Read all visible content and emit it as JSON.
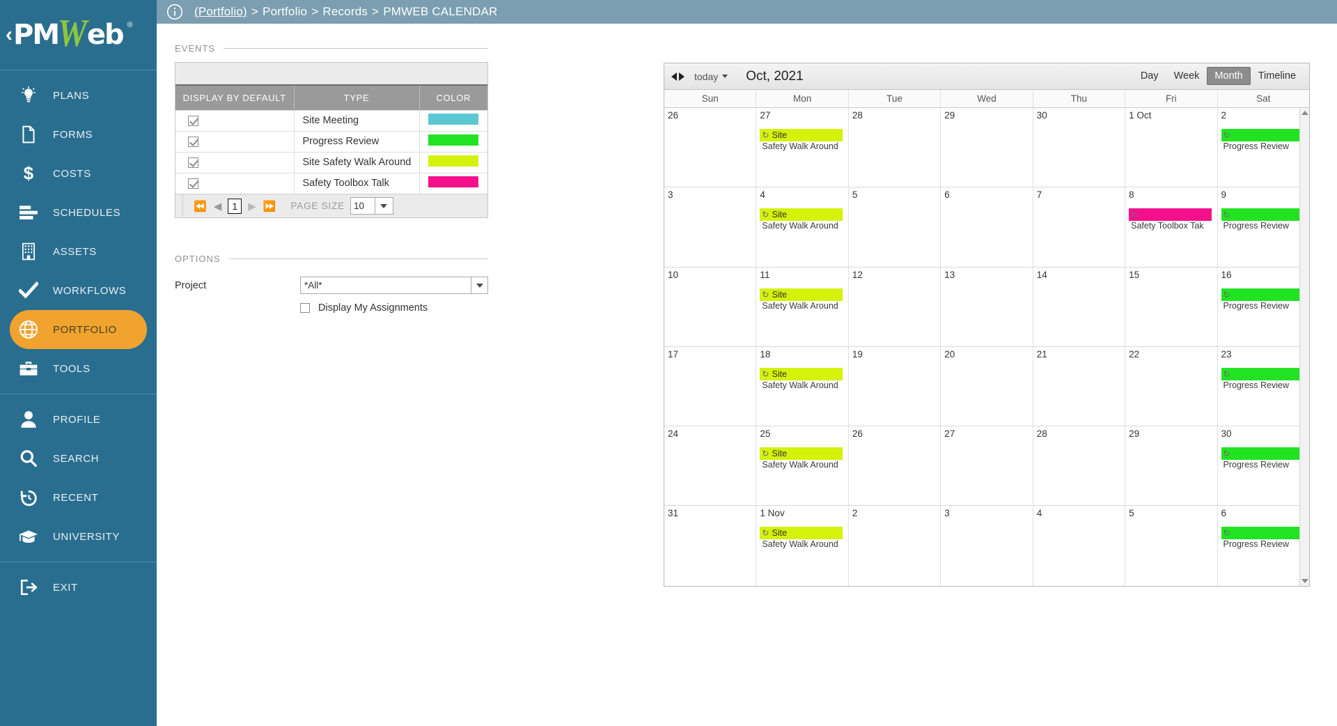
{
  "brand": {
    "chevron": "‹",
    "name": "PMWeb",
    "name_prefix": "PM",
    "name_suffix": "eb",
    "w_letter": "W",
    "registered": "®"
  },
  "sidebar": {
    "group1": [
      {
        "label": "PLANS",
        "icon": "lightbulb-icon",
        "active": false
      },
      {
        "label": "FORMS",
        "icon": "document-icon",
        "active": false
      },
      {
        "label": "COSTS",
        "icon": "dollar-icon",
        "active": false
      },
      {
        "label": "SCHEDULES",
        "icon": "bars-icon",
        "active": false
      },
      {
        "label": "ASSETS",
        "icon": "building-icon",
        "active": false
      },
      {
        "label": "WORKFLOWS",
        "icon": "checkmark-icon",
        "active": false
      },
      {
        "label": "PORTFOLIO",
        "icon": "globe-icon",
        "active": true
      },
      {
        "label": "TOOLS",
        "icon": "toolbox-icon",
        "active": false
      }
    ],
    "group2": [
      {
        "label": "PROFILE",
        "icon": "person-icon",
        "active": false
      },
      {
        "label": "SEARCH",
        "icon": "magnifier-icon",
        "active": false
      },
      {
        "label": "RECENT",
        "icon": "history-icon",
        "active": false
      },
      {
        "label": "UNIVERSITY",
        "icon": "graduation-cap-icon",
        "active": false
      }
    ],
    "group3": [
      {
        "label": "EXIT",
        "icon": "logout-icon",
        "active": false
      }
    ]
  },
  "header": {
    "info_icon": "info-icon",
    "breadcrumb": {
      "root": "(Portfolio)",
      "parts": [
        "Portfolio",
        "Records",
        "PMWEB CALENDAR"
      ],
      "separator": ">"
    }
  },
  "events": {
    "section_title": "EVENTS",
    "columns": [
      "DISPLAY BY DEFAULT",
      "TYPE",
      "COLOR"
    ],
    "rows": [
      {
        "checked": true,
        "type": "Site Meeting",
        "color": "#5bc8d2"
      },
      {
        "checked": true,
        "type": "Progress Review",
        "color": "#22e322"
      },
      {
        "checked": true,
        "type": "Site Safety Walk Around",
        "color": "#d4f20a"
      },
      {
        "checked": true,
        "type": "Safety Toolbox Talk",
        "color": "#f5108b"
      }
    ],
    "pager": {
      "first_icon": "first-page-icon",
      "prev_icon": "prev-page-icon",
      "page": "1",
      "next_icon": "next-page-icon",
      "last_icon": "last-page-icon",
      "page_size_label": "PAGE SIZE",
      "page_size_value": "10"
    }
  },
  "options": {
    "section_title": "OPTIONS",
    "project_label": "Project",
    "project_value": "*All*",
    "display_my_assignments_label": "Display My Assignments",
    "display_my_assignments_checked": false
  },
  "calendar": {
    "toolbar": {
      "prev_icon": "prev-arrow-icon",
      "next_icon": "next-arrow-icon",
      "today_label": "today",
      "today_caret": "chevron-down-icon",
      "title": "Oct, 2021",
      "views": [
        {
          "label": "Day",
          "active": false
        },
        {
          "label": "Week",
          "active": false
        },
        {
          "label": "Month",
          "active": true
        },
        {
          "label": "Timeline",
          "active": false
        }
      ]
    },
    "day_headers": [
      "Sun",
      "Mon",
      "Tue",
      "Wed",
      "Thu",
      "Fri",
      "Sat"
    ],
    "recur_icon": "↻",
    "weeks": [
      [
        {
          "date": "26",
          "events": []
        },
        {
          "date": "27",
          "events": [
            {
              "head": "Site",
              "rest": "Safety Walk Around",
              "color": "#d4f20a"
            }
          ]
        },
        {
          "date": "28",
          "events": []
        },
        {
          "date": "29",
          "events": []
        },
        {
          "date": "30",
          "events": []
        },
        {
          "date": "1 Oct",
          "events": []
        },
        {
          "date": "2",
          "events": [
            {
              "head": "",
              "rest": "Progress Review",
              "color": "#22e322"
            }
          ]
        }
      ],
      [
        {
          "date": "3",
          "events": []
        },
        {
          "date": "4",
          "events": [
            {
              "head": "Site",
              "rest": "Safety Walk Around",
              "color": "#d4f20a"
            }
          ]
        },
        {
          "date": "5",
          "events": []
        },
        {
          "date": "6",
          "events": []
        },
        {
          "date": "7",
          "events": []
        },
        {
          "date": "8",
          "events": [
            {
              "head": "",
              "rest": "Safety Toolbox Tak",
              "color": "#f5108b"
            }
          ]
        },
        {
          "date": "9",
          "events": [
            {
              "head": "",
              "rest": "Progress Review",
              "color": "#22e322"
            }
          ]
        }
      ],
      [
        {
          "date": "10",
          "events": []
        },
        {
          "date": "11",
          "events": [
            {
              "head": "Site",
              "rest": "Safety Walk Around",
              "color": "#d4f20a"
            }
          ]
        },
        {
          "date": "12",
          "events": []
        },
        {
          "date": "13",
          "events": []
        },
        {
          "date": "14",
          "events": []
        },
        {
          "date": "15",
          "events": []
        },
        {
          "date": "16",
          "events": [
            {
              "head": "",
              "rest": "Progress Review",
              "color": "#22e322"
            }
          ]
        }
      ],
      [
        {
          "date": "17",
          "events": []
        },
        {
          "date": "18",
          "events": [
            {
              "head": "Site",
              "rest": "Safety Walk Around",
              "color": "#d4f20a"
            }
          ]
        },
        {
          "date": "19",
          "events": []
        },
        {
          "date": "20",
          "events": []
        },
        {
          "date": "21",
          "events": []
        },
        {
          "date": "22",
          "events": []
        },
        {
          "date": "23",
          "events": [
            {
              "head": "",
              "rest": "Progress Review",
              "color": "#22e322"
            }
          ]
        }
      ],
      [
        {
          "date": "24",
          "events": []
        },
        {
          "date": "25",
          "events": [
            {
              "head": "Site",
              "rest": "Safety Walk Around",
              "color": "#d4f20a"
            }
          ]
        },
        {
          "date": "26",
          "events": []
        },
        {
          "date": "27",
          "events": []
        },
        {
          "date": "28",
          "events": []
        },
        {
          "date": "29",
          "events": []
        },
        {
          "date": "30",
          "events": [
            {
              "head": "",
              "rest": "Progress Review",
              "color": "#22e322"
            }
          ]
        }
      ],
      [
        {
          "date": "31",
          "events": []
        },
        {
          "date": "1 Nov",
          "events": [
            {
              "head": "Site",
              "rest": "Safety Walk Around",
              "color": "#d4f20a"
            }
          ]
        },
        {
          "date": "2",
          "events": []
        },
        {
          "date": "3",
          "events": []
        },
        {
          "date": "4",
          "events": []
        },
        {
          "date": "5",
          "events": []
        },
        {
          "date": "6",
          "events": [
            {
              "head": "",
              "rest": "Progress Review",
              "color": "#22e322"
            }
          ]
        }
      ]
    ]
  },
  "colors": {
    "sidebar_bg": "#2a6e8f",
    "active_pill": "#f0a32e",
    "topbar_bg": "#7b9eb0",
    "brand_green": "#8cc63e"
  }
}
